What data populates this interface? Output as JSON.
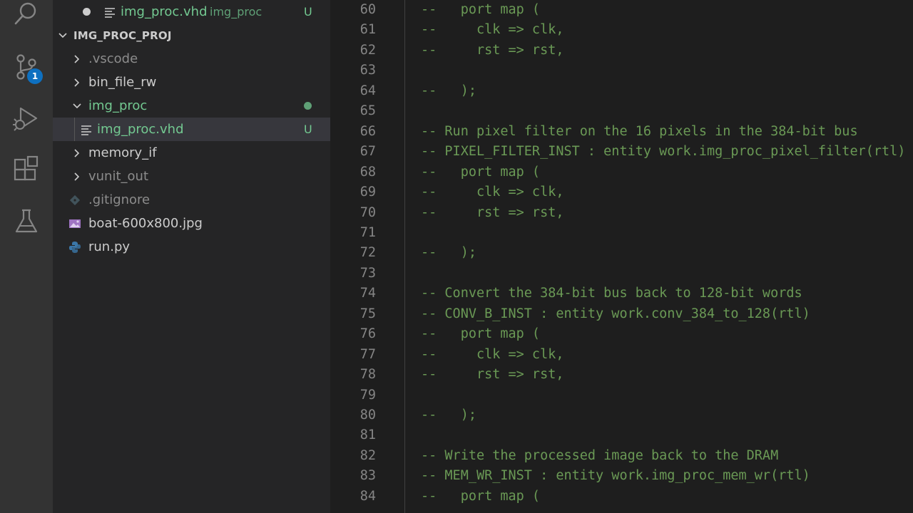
{
  "activity_bar": {
    "scm_badge": "1",
    "icons": [
      "search-icon",
      "source-control-icon",
      "run-debug-icon",
      "extensions-icon",
      "testing-icon"
    ]
  },
  "explorer": {
    "open_editor": {
      "name": "img_proc.vhd",
      "folder": "img_proc",
      "status": "U"
    },
    "project_title": "IMG_PROC_PROJ",
    "items": [
      {
        "label": ".vscode",
        "type": "folder",
        "expanded": false
      },
      {
        "label": "bin_file_rw",
        "type": "folder",
        "expanded": false
      },
      {
        "label": "img_proc",
        "type": "folder",
        "expanded": true,
        "modified": true
      },
      {
        "label": "img_proc.vhd",
        "type": "file",
        "status": "U",
        "selected": true
      },
      {
        "label": "memory_if",
        "type": "folder",
        "expanded": false
      },
      {
        "label": "vunit_out",
        "type": "folder",
        "expanded": false
      },
      {
        "label": ".gitignore",
        "type": "file"
      },
      {
        "label": "boat-600x800.jpg",
        "type": "image"
      },
      {
        "label": "run.py",
        "type": "python"
      }
    ]
  },
  "editor": {
    "lines": [
      {
        "n": "60",
        "text": "--   port map ("
      },
      {
        "n": "61",
        "text": "--     clk => clk,"
      },
      {
        "n": "62",
        "text": "--     rst => rst,"
      },
      {
        "n": "63",
        "text": ""
      },
      {
        "n": "64",
        "text": "--   );"
      },
      {
        "n": "65",
        "text": ""
      },
      {
        "n": "66",
        "text": "-- Run pixel filter on the 16 pixels in the 384-bit bus"
      },
      {
        "n": "67",
        "text": "-- PIXEL_FILTER_INST : entity work.img_proc_pixel_filter(rtl)"
      },
      {
        "n": "68",
        "text": "--   port map ("
      },
      {
        "n": "69",
        "text": "--     clk => clk,"
      },
      {
        "n": "70",
        "text": "--     rst => rst,"
      },
      {
        "n": "71",
        "text": ""
      },
      {
        "n": "72",
        "text": "--   );"
      },
      {
        "n": "73",
        "text": ""
      },
      {
        "n": "74",
        "text": "-- Convert the 384-bit bus back to 128-bit words"
      },
      {
        "n": "75",
        "text": "-- CONV_B_INST : entity work.conv_384_to_128(rtl)"
      },
      {
        "n": "76",
        "text": "--   port map ("
      },
      {
        "n": "77",
        "text": "--     clk => clk,"
      },
      {
        "n": "78",
        "text": "--     rst => rst,"
      },
      {
        "n": "79",
        "text": ""
      },
      {
        "n": "80",
        "text": "--   );"
      },
      {
        "n": "81",
        "text": ""
      },
      {
        "n": "82",
        "text": "-- Write the processed image back to the DRAM"
      },
      {
        "n": "83",
        "text": "-- MEM_WR_INST : entity work.img_proc_mem_wr(rtl)"
      },
      {
        "n": "84",
        "text": "--   port map ("
      }
    ]
  },
  "colors": {
    "comment": "#6a9955",
    "line_number": "#858585",
    "git_untracked": "#73c991",
    "badge": "#0e70c0"
  }
}
